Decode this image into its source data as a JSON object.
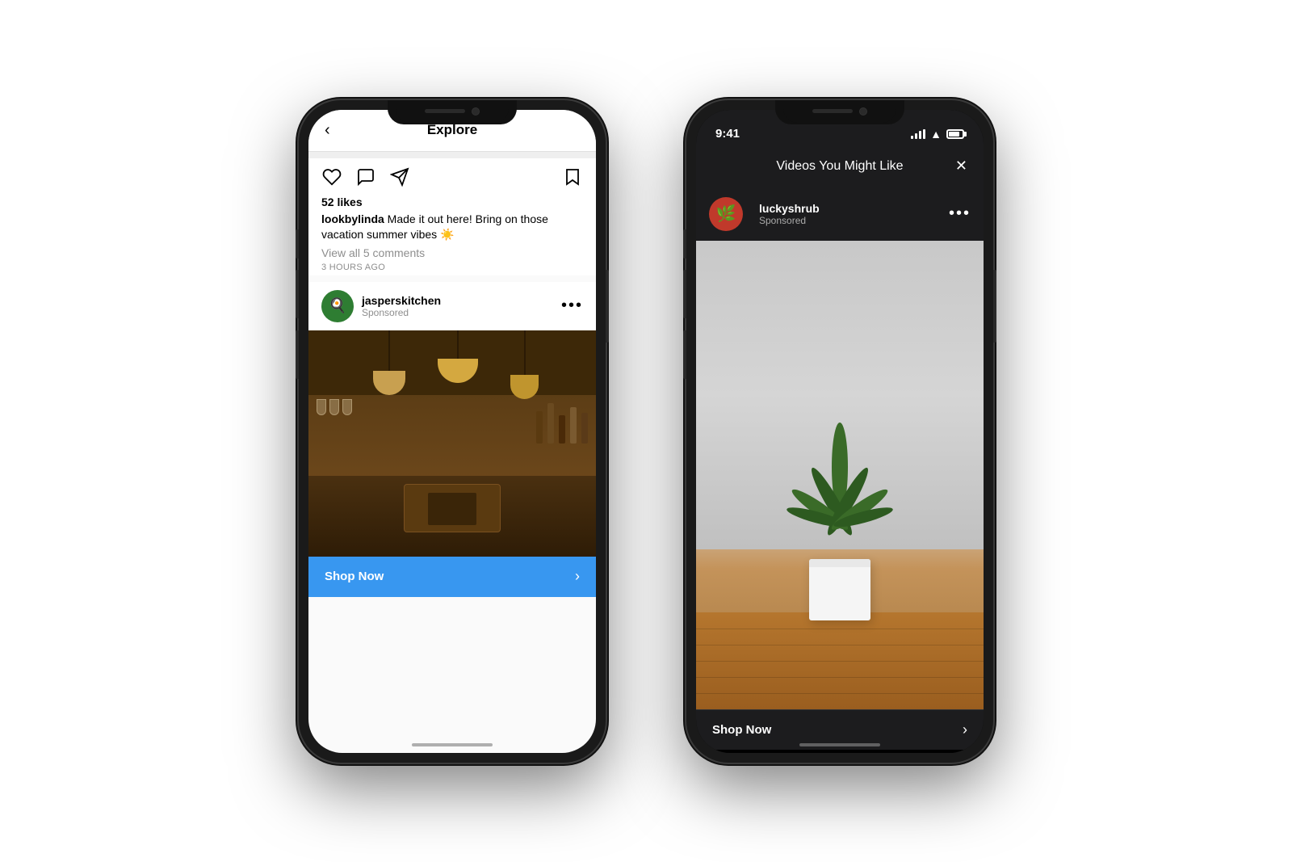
{
  "phone1": {
    "nav": {
      "back_label": "‹",
      "title": "Explore"
    },
    "post": {
      "likes": "52 likes",
      "caption_user": "lookbylinda",
      "caption_text": " Made it out here! Bring on those vacation summer vibes ☀️",
      "view_comments": "View all 5 comments",
      "timestamp": "3 HOURS AGO"
    },
    "sponsored": {
      "username": "jasperskitchen",
      "tag": "Sponsored",
      "shop_now": "Shop Now"
    }
  },
  "phone2": {
    "status": {
      "time": "9:41"
    },
    "nav": {
      "title": "Videos You Might Like",
      "close": "✕"
    },
    "sponsored": {
      "username": "luckyshrub",
      "tag": "Sponsored",
      "shop_now": "Shop Now"
    }
  }
}
